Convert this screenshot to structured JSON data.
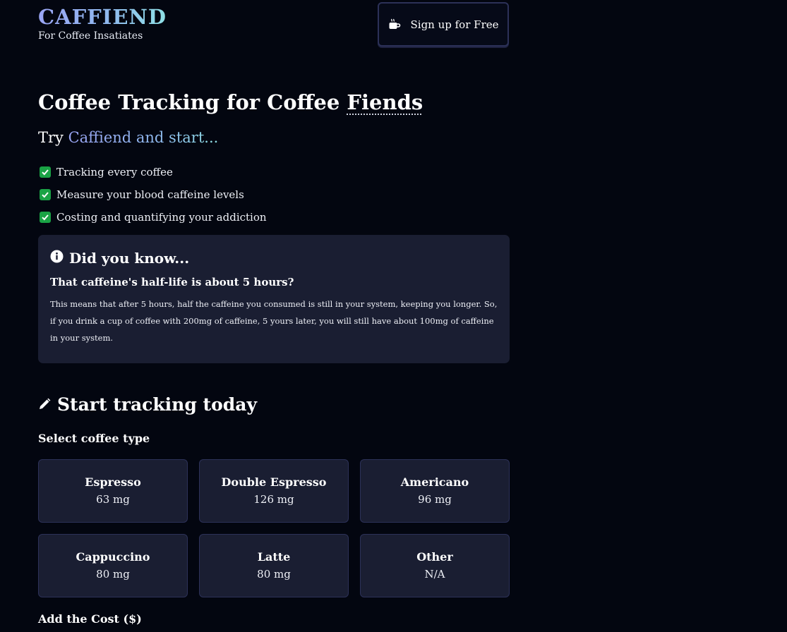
{
  "header": {
    "brand_title": "CAFFIEND",
    "tagline": "For Coffee Insatiates",
    "signup_label": "Sign up for Free",
    "signup_icon": "mug-icon"
  },
  "hero": {
    "title_prefix": "Coffee Tracking for Coffee ",
    "title_abbr": "Fiends",
    "try_prefix": "Try ",
    "try_highlight": "Caffiend and start...",
    "features": [
      "Tracking every coffee",
      "Measure your blood caffeine levels",
      "Costing and quantifying your addiction"
    ]
  },
  "info_card": {
    "icon": "info-icon",
    "heading": "Did you know...",
    "subheading": "That caffeine's half-life is about 5 hours?",
    "body": "This means that after 5 hours, half the caffeine you consumed is still in your system, keeping you longer. So, if you drink a cup of coffee with 200mg of caffeine, 5 yours later, you will still have about 100mg of caffeine in your system."
  },
  "tracker": {
    "icon": "pencil-icon",
    "title": "Start tracking today",
    "select_label": "Select coffee type",
    "coffee_types": [
      {
        "name": "Espresso",
        "caffeine": "63 mg"
      },
      {
        "name": "Double Espresso",
        "caffeine": "126 mg"
      },
      {
        "name": "Americano",
        "caffeine": "96 mg"
      },
      {
        "name": "Cappuccino",
        "caffeine": "80 mg"
      },
      {
        "name": "Latte",
        "caffeine": "80 mg"
      },
      {
        "name": "Other",
        "caffeine": "N/A"
      }
    ],
    "cost_label": "Add the Cost ($)"
  },
  "colors": {
    "background": "#030610",
    "card": "#1a1e32",
    "card_border": "#2c3158",
    "gradient_start": "#9aa5f5",
    "gradient_end": "#8fe0e6",
    "check_green": "#1aa345"
  }
}
